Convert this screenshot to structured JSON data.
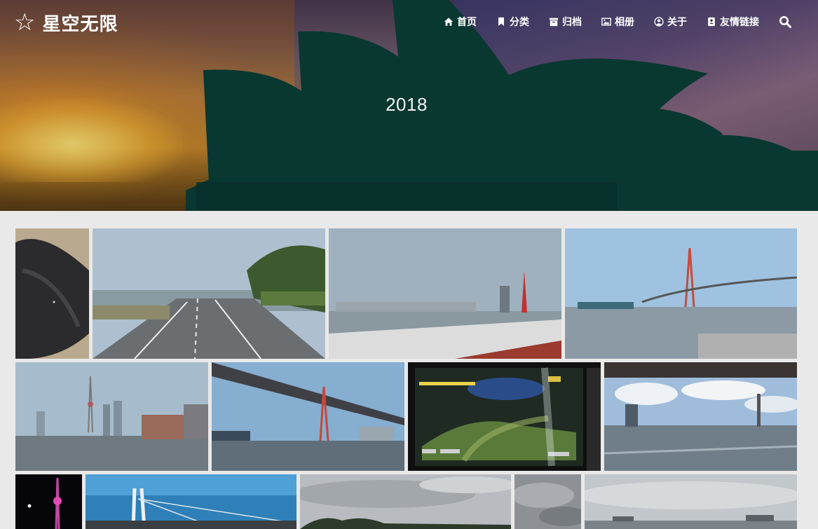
{
  "site": {
    "brand_icon": "star-outline-icon",
    "brand_name": "星空无限"
  },
  "nav": {
    "items": [
      {
        "label": "首页",
        "icon": "home-icon"
      },
      {
        "label": "分类",
        "icon": "bookmark-icon"
      },
      {
        "label": "归档",
        "icon": "archive-icon"
      },
      {
        "label": "相册",
        "icon": "image-icon"
      },
      {
        "label": "关于",
        "icon": "user-circle-icon"
      },
      {
        "label": "友情链接",
        "icon": "address-book-icon"
      }
    ],
    "search_icon": "search-icon"
  },
  "hero": {
    "title": "2018"
  },
  "colors": {
    "page_background": "#e9e9e9",
    "nav_text": "#ffffff"
  },
  "gallery": {
    "photos": [
      {
        "subject": "dark fabric close-up"
      },
      {
        "subject": "riverside road with trees"
      },
      {
        "subject": "river skyline with red tower"
      },
      {
        "subject": "cable-stayed bridge over river with ship"
      },
      {
        "subject": "city skyline with TV tower"
      },
      {
        "subject": "underside of red bridge"
      },
      {
        "subject": "monitor with game screen"
      },
      {
        "subject": "river under clouds"
      },
      {
        "subject": "TV tower at night"
      },
      {
        "subject": "bridge tower in blue sky"
      },
      {
        "subject": "cloudy sky over trees"
      },
      {
        "subject": "grey clouds"
      },
      {
        "subject": "overcast riverside"
      }
    ]
  }
}
